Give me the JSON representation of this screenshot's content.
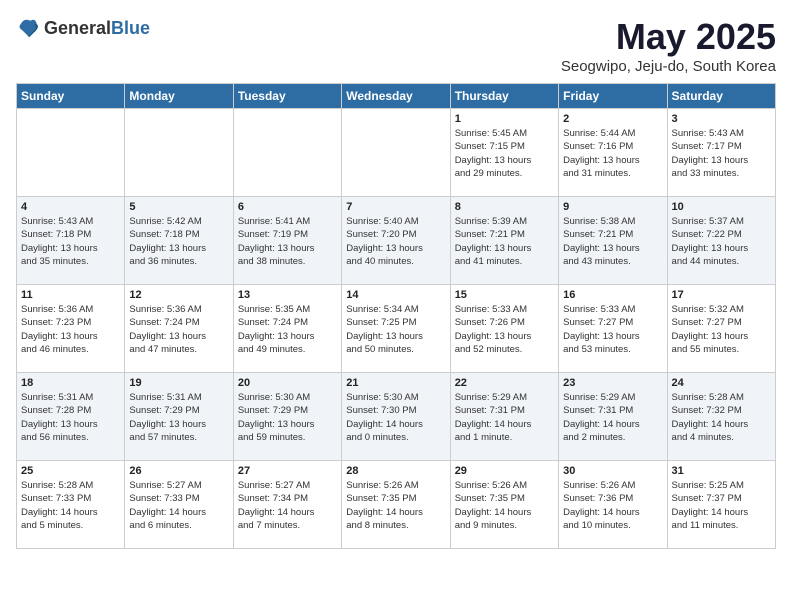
{
  "logo": {
    "general": "General",
    "blue": "Blue"
  },
  "title": "May 2025",
  "subtitle": "Seogwipo, Jeju-do, South Korea",
  "days_header": [
    "Sunday",
    "Monday",
    "Tuesday",
    "Wednesday",
    "Thursday",
    "Friday",
    "Saturday"
  ],
  "weeks": [
    [
      {
        "day": "",
        "info": ""
      },
      {
        "day": "",
        "info": ""
      },
      {
        "day": "",
        "info": ""
      },
      {
        "day": "",
        "info": ""
      },
      {
        "day": "1",
        "info": "Sunrise: 5:45 AM\nSunset: 7:15 PM\nDaylight: 13 hours\nand 29 minutes."
      },
      {
        "day": "2",
        "info": "Sunrise: 5:44 AM\nSunset: 7:16 PM\nDaylight: 13 hours\nand 31 minutes."
      },
      {
        "day": "3",
        "info": "Sunrise: 5:43 AM\nSunset: 7:17 PM\nDaylight: 13 hours\nand 33 minutes."
      }
    ],
    [
      {
        "day": "4",
        "info": "Sunrise: 5:43 AM\nSunset: 7:18 PM\nDaylight: 13 hours\nand 35 minutes."
      },
      {
        "day": "5",
        "info": "Sunrise: 5:42 AM\nSunset: 7:18 PM\nDaylight: 13 hours\nand 36 minutes."
      },
      {
        "day": "6",
        "info": "Sunrise: 5:41 AM\nSunset: 7:19 PM\nDaylight: 13 hours\nand 38 minutes."
      },
      {
        "day": "7",
        "info": "Sunrise: 5:40 AM\nSunset: 7:20 PM\nDaylight: 13 hours\nand 40 minutes."
      },
      {
        "day": "8",
        "info": "Sunrise: 5:39 AM\nSunset: 7:21 PM\nDaylight: 13 hours\nand 41 minutes."
      },
      {
        "day": "9",
        "info": "Sunrise: 5:38 AM\nSunset: 7:21 PM\nDaylight: 13 hours\nand 43 minutes."
      },
      {
        "day": "10",
        "info": "Sunrise: 5:37 AM\nSunset: 7:22 PM\nDaylight: 13 hours\nand 44 minutes."
      }
    ],
    [
      {
        "day": "11",
        "info": "Sunrise: 5:36 AM\nSunset: 7:23 PM\nDaylight: 13 hours\nand 46 minutes."
      },
      {
        "day": "12",
        "info": "Sunrise: 5:36 AM\nSunset: 7:24 PM\nDaylight: 13 hours\nand 47 minutes."
      },
      {
        "day": "13",
        "info": "Sunrise: 5:35 AM\nSunset: 7:24 PM\nDaylight: 13 hours\nand 49 minutes."
      },
      {
        "day": "14",
        "info": "Sunrise: 5:34 AM\nSunset: 7:25 PM\nDaylight: 13 hours\nand 50 minutes."
      },
      {
        "day": "15",
        "info": "Sunrise: 5:33 AM\nSunset: 7:26 PM\nDaylight: 13 hours\nand 52 minutes."
      },
      {
        "day": "16",
        "info": "Sunrise: 5:33 AM\nSunset: 7:27 PM\nDaylight: 13 hours\nand 53 minutes."
      },
      {
        "day": "17",
        "info": "Sunrise: 5:32 AM\nSunset: 7:27 PM\nDaylight: 13 hours\nand 55 minutes."
      }
    ],
    [
      {
        "day": "18",
        "info": "Sunrise: 5:31 AM\nSunset: 7:28 PM\nDaylight: 13 hours\nand 56 minutes."
      },
      {
        "day": "19",
        "info": "Sunrise: 5:31 AM\nSunset: 7:29 PM\nDaylight: 13 hours\nand 57 minutes."
      },
      {
        "day": "20",
        "info": "Sunrise: 5:30 AM\nSunset: 7:29 PM\nDaylight: 13 hours\nand 59 minutes."
      },
      {
        "day": "21",
        "info": "Sunrise: 5:30 AM\nSunset: 7:30 PM\nDaylight: 14 hours\nand 0 minutes."
      },
      {
        "day": "22",
        "info": "Sunrise: 5:29 AM\nSunset: 7:31 PM\nDaylight: 14 hours\nand 1 minute."
      },
      {
        "day": "23",
        "info": "Sunrise: 5:29 AM\nSunset: 7:31 PM\nDaylight: 14 hours\nand 2 minutes."
      },
      {
        "day": "24",
        "info": "Sunrise: 5:28 AM\nSunset: 7:32 PM\nDaylight: 14 hours\nand 4 minutes."
      }
    ],
    [
      {
        "day": "25",
        "info": "Sunrise: 5:28 AM\nSunset: 7:33 PM\nDaylight: 14 hours\nand 5 minutes."
      },
      {
        "day": "26",
        "info": "Sunrise: 5:27 AM\nSunset: 7:33 PM\nDaylight: 14 hours\nand 6 minutes."
      },
      {
        "day": "27",
        "info": "Sunrise: 5:27 AM\nSunset: 7:34 PM\nDaylight: 14 hours\nand 7 minutes."
      },
      {
        "day": "28",
        "info": "Sunrise: 5:26 AM\nSunset: 7:35 PM\nDaylight: 14 hours\nand 8 minutes."
      },
      {
        "day": "29",
        "info": "Sunrise: 5:26 AM\nSunset: 7:35 PM\nDaylight: 14 hours\nand 9 minutes."
      },
      {
        "day": "30",
        "info": "Sunrise: 5:26 AM\nSunset: 7:36 PM\nDaylight: 14 hours\nand 10 minutes."
      },
      {
        "day": "31",
        "info": "Sunrise: 5:25 AM\nSunset: 7:37 PM\nDaylight: 14 hours\nand 11 minutes."
      }
    ]
  ]
}
